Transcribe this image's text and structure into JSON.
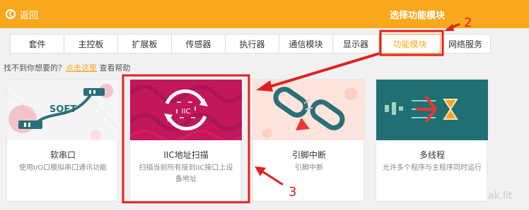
{
  "header": {
    "back_label": "返回",
    "title": "选择功能模块"
  },
  "tabs": [
    {
      "label": "套件"
    },
    {
      "label": "主控板"
    },
    {
      "label": "扩展板"
    },
    {
      "label": "传感器"
    },
    {
      "label": "执行器"
    },
    {
      "label": "通信模块"
    },
    {
      "label": "显示器"
    },
    {
      "label": "功能模块",
      "active": true
    },
    {
      "label": "网络服务"
    }
  ],
  "help": {
    "prefix": "找不到你想要的？",
    "link": "点击这里",
    "suffix": " 查看帮助"
  },
  "cards": [
    {
      "name": "软串口",
      "desc": "使用I/O口模拟串口通讯功能",
      "image_text": "SOFT"
    },
    {
      "name": "IIC地址扫描",
      "desc": "扫描当前所有接到IIC接口上设备地址",
      "image_text": "IIC"
    },
    {
      "name": "引脚中断",
      "desc": "引脚中断"
    },
    {
      "name": "多线程",
      "desc": "允许多个程序与主程序同时运行"
    }
  ],
  "annotations": {
    "step2": "2",
    "step3": "3"
  },
  "watermark": "ak.lit",
  "colors": {
    "accent": "#f7a81d",
    "annotation": "#e02020"
  }
}
